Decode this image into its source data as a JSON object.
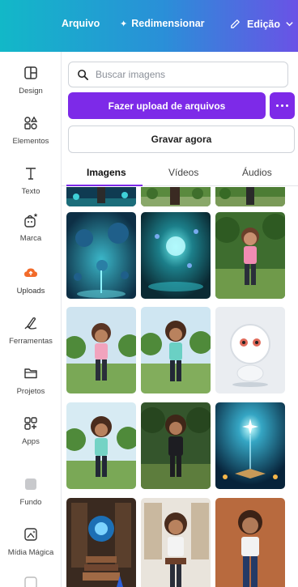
{
  "topbar": {
    "file_label": "Arquivo",
    "resize_label": "Redimensionar",
    "edit_label": "Edição"
  },
  "sidebar": {
    "items": [
      {
        "label": "Design",
        "icon": "design-icon"
      },
      {
        "label": "Elementos",
        "icon": "elements-icon"
      },
      {
        "label": "Texto",
        "icon": "text-icon"
      },
      {
        "label": "Marca",
        "icon": "brand-icon"
      },
      {
        "label": "Uploads",
        "icon": "uploads-icon"
      },
      {
        "label": "Ferramentas",
        "icon": "tools-icon"
      },
      {
        "label": "Projetos",
        "icon": "folder-icon"
      },
      {
        "label": "Apps",
        "icon": "apps-icon"
      },
      {
        "label": "Fundo",
        "icon": "background-icon"
      },
      {
        "label": "Mídia Mágica",
        "icon": "magic-media-icon"
      }
    ]
  },
  "panel": {
    "search_placeholder": "Buscar imagens",
    "upload_label": "Fazer upload de arquivos",
    "record_label": "Gravar agora",
    "tabs": [
      {
        "label": "Imagens",
        "active": true
      },
      {
        "label": "Vídeos",
        "active": false
      },
      {
        "label": "Áudios",
        "active": false
      }
    ]
  },
  "colors": {
    "accent": "#7d2ae8",
    "topbar_start": "#12b8c8",
    "topbar_end": "#6a52e6",
    "uploads_icon": "#f26b2a"
  }
}
